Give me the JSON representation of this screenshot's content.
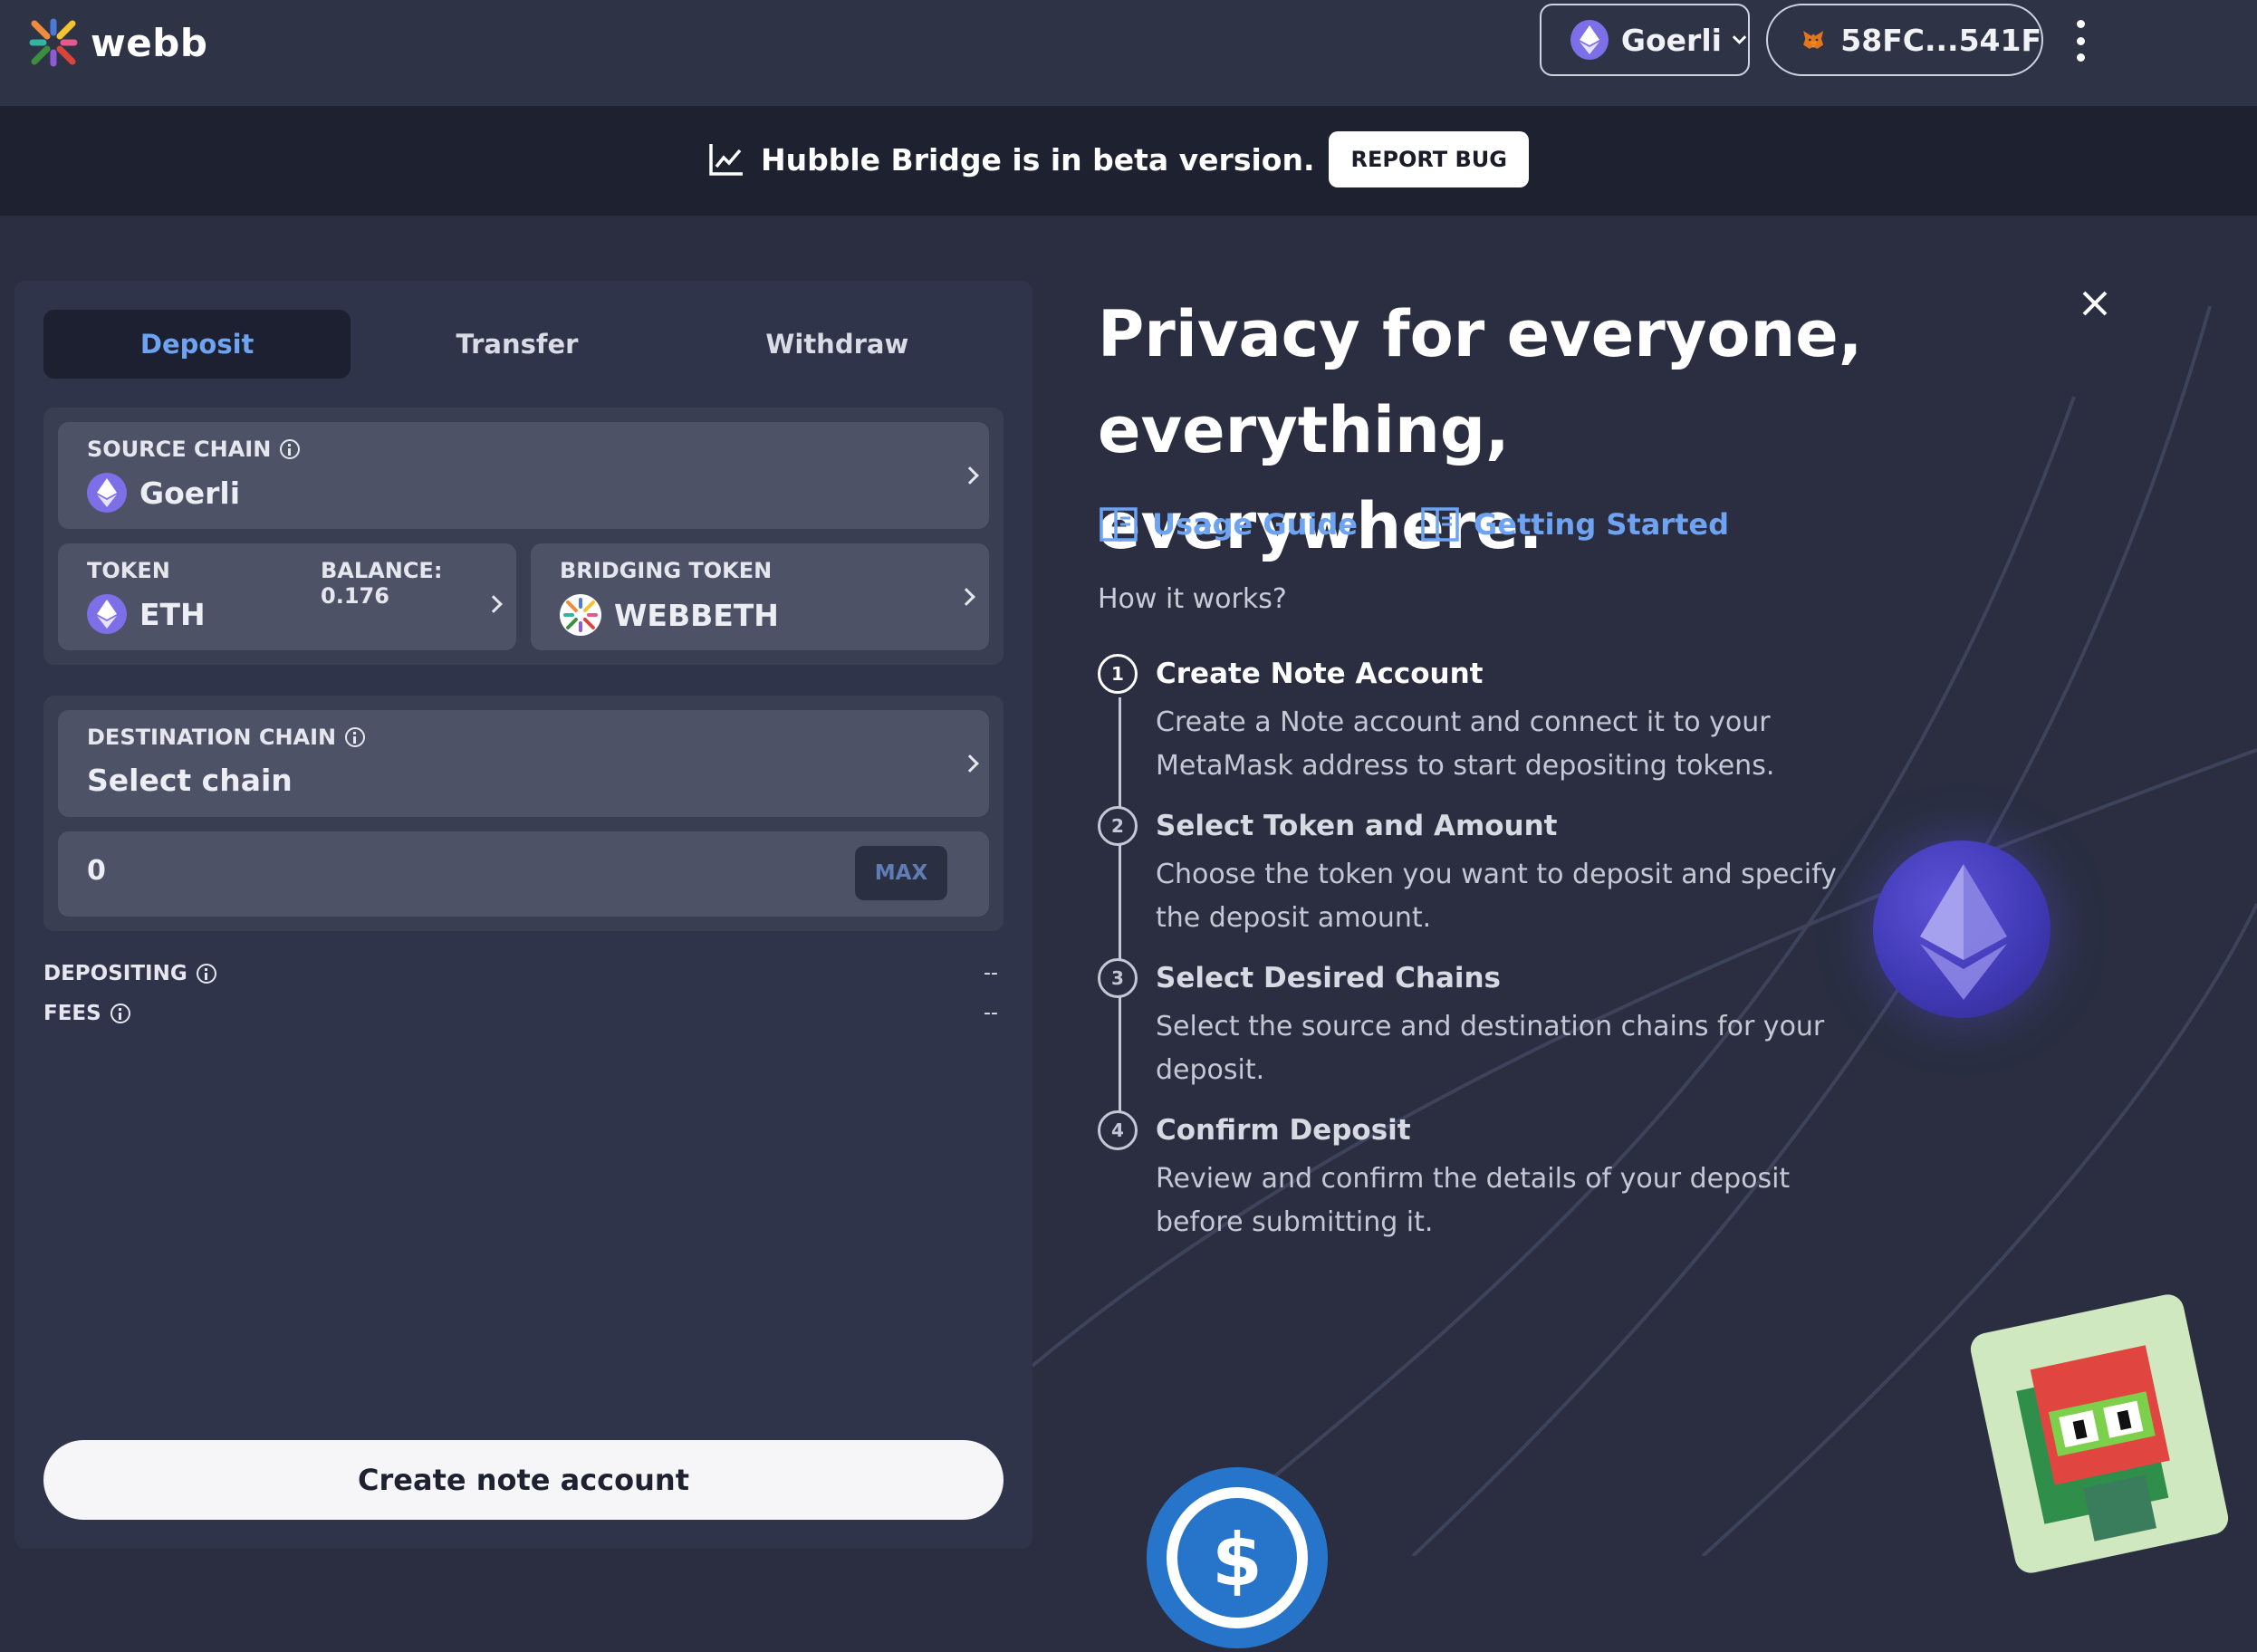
{
  "app": {
    "brand": "webb"
  },
  "header": {
    "network_label": "Goerli",
    "account_label": "58FC...541F"
  },
  "banner": {
    "text": "Hubble Bridge is in beta version.",
    "report_label": "REPORT BUG"
  },
  "tabs": [
    {
      "label": "Deposit",
      "active": true
    },
    {
      "label": "Transfer",
      "active": false
    },
    {
      "label": "Withdraw",
      "active": false
    }
  ],
  "form": {
    "source_chain": {
      "label": "SOURCE CHAIN",
      "value": "Goerli"
    },
    "token": {
      "label": "TOKEN",
      "balance": "BALANCE: 0.176",
      "value": "ETH"
    },
    "bridging_token": {
      "label": "BRIDGING TOKEN",
      "value": "WEBBETH"
    },
    "destination_chain": {
      "label": "DESTINATION CHAIN",
      "value": "Select chain"
    },
    "amount": {
      "value": "0",
      "max_label": "MAX"
    },
    "depositing": {
      "label": "DEPOSITING",
      "value": "--"
    },
    "fees": {
      "label": "FEES",
      "value": "--"
    },
    "submit_label": "Create note account"
  },
  "info": {
    "hero_line1": "Privacy for everyone,",
    "hero_line2": "everything, everywhere.",
    "links": [
      {
        "label": "Usage Guide"
      },
      {
        "label": "Getting Started"
      }
    ],
    "how_label": "How it works?",
    "steps": [
      {
        "num": "1",
        "title": "Create Note Account",
        "desc": "Create a Note account and connect it to your MetaMask address to start depositing tokens."
      },
      {
        "num": "2",
        "title": "Select Token and Amount",
        "desc": "Choose the token you want to deposit and specify the deposit amount."
      },
      {
        "num": "3",
        "title": "Select Desired Chains",
        "desc": "Select the source and destination chains for your deposit."
      },
      {
        "num": "4",
        "title": "Confirm Deposit",
        "desc": "Review and confirm the details of your deposit before submitting it."
      }
    ]
  },
  "colors": {
    "accent": "#6ea3f2",
    "bg": "#2a2e40",
    "panel": "#30344a",
    "card": "#4d5266",
    "banner": "#1e2130"
  },
  "icons": [
    "webb-logo-icon",
    "ethereum-icon",
    "chevron-down-icon",
    "metamask-fox-icon",
    "kebab-menu-icon",
    "chart-line-icon",
    "info-icon",
    "chevron-right-icon",
    "webbeth-token-icon",
    "close-icon",
    "book-icon",
    "usdc-coin-icon",
    "nft-avatar-icon"
  ]
}
